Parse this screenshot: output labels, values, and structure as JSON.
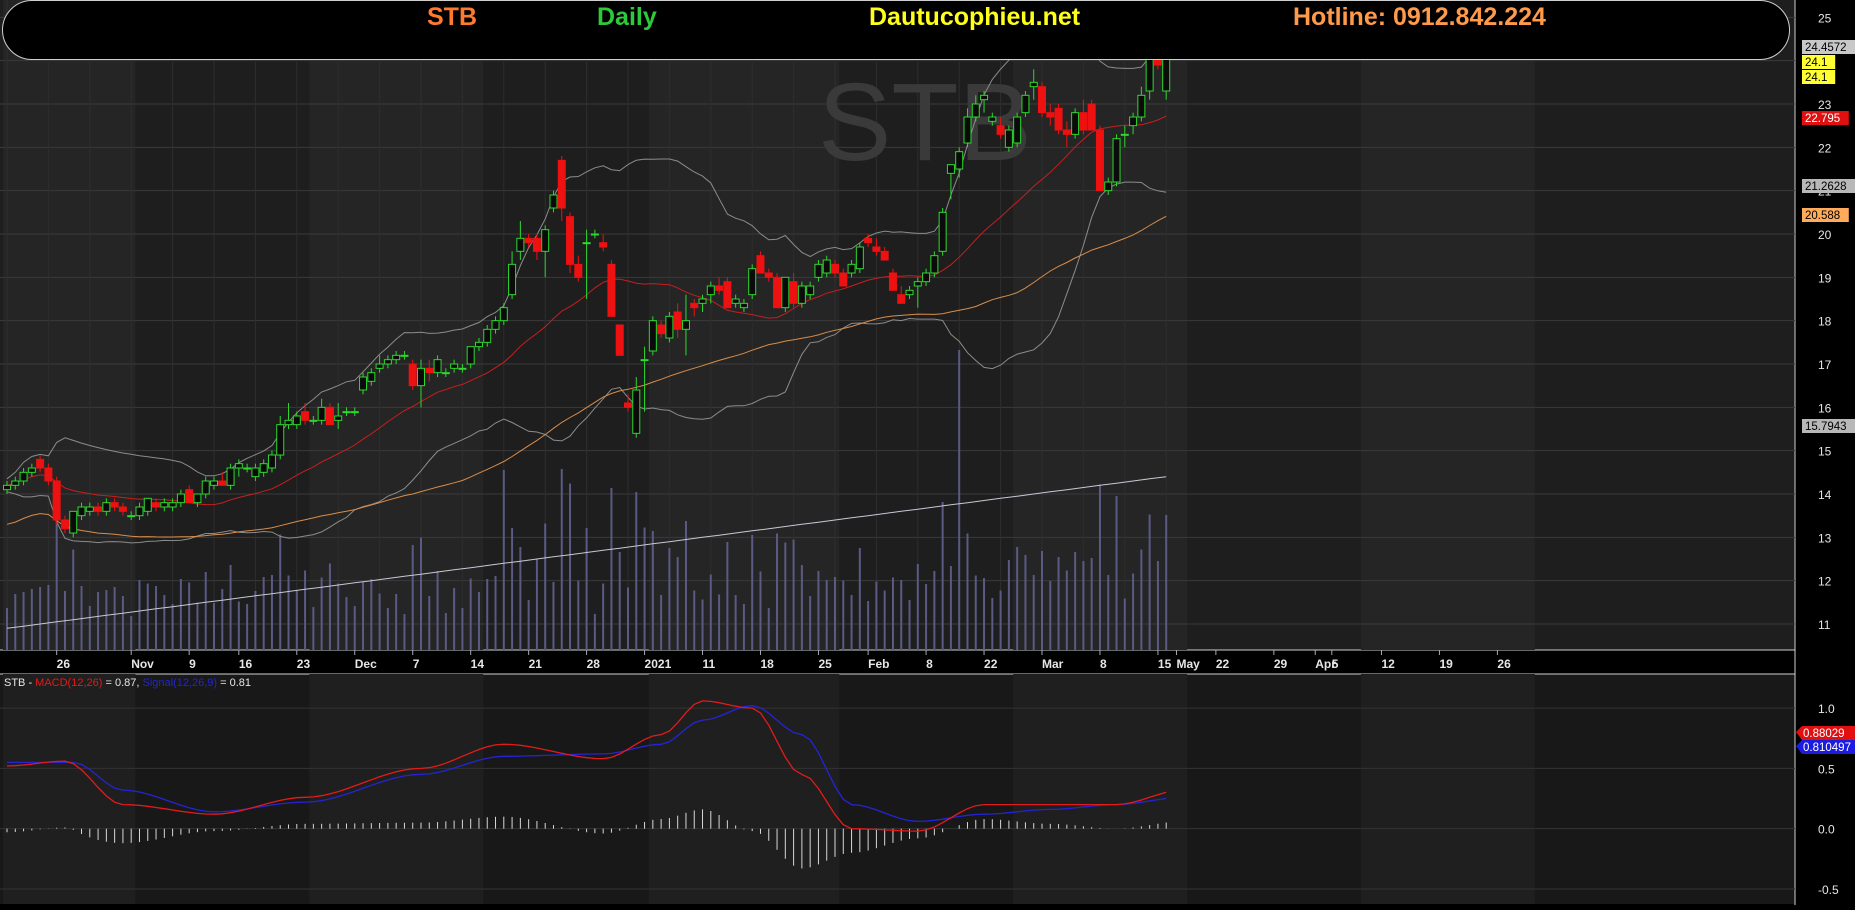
{
  "header": {
    "ticker": "STB",
    "period": "Daily",
    "site": "Dautucophieu.net",
    "hotline": "Hotline: 0912.842.224"
  },
  "chart_data": [
    {
      "type": "candlestick",
      "title": "STB",
      "x_tick_labels": [
        "26",
        "Nov",
        "9",
        "16",
        "23",
        "Dec",
        "7",
        "14",
        "21",
        "28",
        "2021",
        "11",
        "18",
        "25",
        "Feb",
        "8",
        "22",
        "Mar",
        "8",
        "15",
        "22",
        "29",
        "Apr",
        "5",
        "12",
        "19",
        "26",
        "May"
      ],
      "ylim": [
        10.4,
        25.4
      ],
      "y_ticks": [
        11,
        12,
        13,
        14,
        15,
        16,
        17,
        18,
        19,
        20,
        21,
        22,
        23,
        24,
        25
      ],
      "grid": true,
      "watermark": "STB",
      "candles": [
        [
          14.1,
          14.3,
          14.0,
          14.2
        ],
        [
          14.2,
          14.4,
          14.1,
          14.3
        ],
        [
          14.3,
          14.6,
          14.2,
          14.5
        ],
        [
          14.5,
          14.7,
          14.4,
          14.6
        ],
        [
          14.8,
          14.9,
          14.5,
          14.6
        ],
        [
          14.6,
          14.7,
          14.2,
          14.3
        ],
        [
          14.3,
          14.4,
          13.3,
          13.4
        ],
        [
          13.4,
          13.5,
          13.1,
          13.2
        ],
        [
          13.1,
          13.6,
          13.0,
          13.6
        ],
        [
          13.5,
          13.8,
          13.4,
          13.7
        ],
        [
          13.6,
          13.8,
          13.5,
          13.7
        ],
        [
          13.7,
          13.8,
          13.5,
          13.6
        ],
        [
          13.6,
          13.9,
          13.5,
          13.8
        ],
        [
          13.8,
          13.9,
          13.6,
          13.7
        ],
        [
          13.7,
          13.8,
          13.5,
          13.6
        ],
        [
          13.5,
          13.6,
          13.4,
          13.5
        ],
        [
          13.5,
          13.8,
          13.4,
          13.7
        ],
        [
          13.6,
          13.9,
          13.5,
          13.9
        ],
        [
          13.8,
          13.9,
          13.6,
          13.7
        ],
        [
          13.7,
          13.9,
          13.6,
          13.8
        ],
        [
          13.7,
          13.9,
          13.6,
          13.8
        ],
        [
          13.8,
          14.1,
          13.7,
          14.0
        ],
        [
          14.1,
          14.2,
          13.8,
          13.8
        ],
        [
          13.8,
          14.0,
          13.7,
          14.0
        ],
        [
          14.0,
          14.4,
          13.9,
          14.3
        ],
        [
          14.2,
          14.4,
          14.1,
          14.3
        ],
        [
          14.3,
          14.5,
          14.2,
          14.2
        ],
        [
          14.2,
          14.7,
          14.1,
          14.6
        ],
        [
          14.6,
          14.8,
          14.4,
          14.7
        ],
        [
          14.6,
          14.7,
          14.5,
          14.6
        ],
        [
          14.4,
          14.7,
          14.3,
          14.6
        ],
        [
          14.5,
          14.8,
          14.4,
          14.7
        ],
        [
          14.6,
          15.0,
          14.5,
          14.9
        ],
        [
          14.9,
          15.8,
          14.8,
          15.6
        ],
        [
          15.6,
          16.1,
          15.5,
          15.7
        ],
        [
          15.6,
          15.9,
          15.5,
          15.8
        ],
        [
          15.9,
          16.1,
          15.6,
          15.7
        ],
        [
          15.7,
          15.8,
          15.6,
          15.7
        ],
        [
          15.7,
          16.2,
          15.6,
          16.0
        ],
        [
          16.0,
          16.1,
          15.6,
          15.6
        ],
        [
          15.7,
          16.1,
          15.5,
          15.8
        ],
        [
          15.9,
          16.0,
          15.8,
          15.9
        ],
        [
          15.9,
          16.0,
          15.8,
          15.9
        ],
        [
          16.4,
          16.8,
          16.3,
          16.7
        ],
        [
          16.6,
          16.9,
          16.5,
          16.8
        ],
        [
          16.9,
          17.2,
          16.8,
          17.0
        ],
        [
          17.0,
          17.2,
          16.9,
          17.1
        ],
        [
          17.1,
          17.3,
          17.0,
          17.2
        ],
        [
          17.2,
          17.3,
          17.1,
          17.2
        ],
        [
          17.0,
          17.1,
          16.4,
          16.5
        ],
        [
          16.5,
          17.1,
          16.0,
          16.9
        ],
        [
          16.9,
          17.1,
          16.6,
          16.8
        ],
        [
          16.8,
          17.2,
          16.7,
          17.1
        ],
        [
          16.8,
          16.9,
          16.7,
          16.8
        ],
        [
          16.9,
          17.1,
          16.8,
          17.0
        ],
        [
          16.9,
          17.0,
          16.8,
          16.9
        ],
        [
          17.0,
          17.4,
          16.9,
          17.4
        ],
        [
          17.4,
          17.6,
          17.3,
          17.5
        ],
        [
          17.5,
          17.9,
          17.4,
          17.8
        ],
        [
          17.8,
          18.1,
          17.7,
          18.0
        ],
        [
          18.0,
          18.4,
          17.9,
          18.3
        ],
        [
          18.6,
          19.6,
          18.5,
          19.3
        ],
        [
          19.6,
          20.3,
          19.4,
          19.9
        ],
        [
          19.9,
          20.0,
          19.7,
          19.8
        ],
        [
          19.9,
          20.0,
          19.4,
          19.6
        ],
        [
          19.6,
          20.2,
          19.0,
          20.1
        ],
        [
          20.6,
          21.0,
          20.5,
          20.9
        ],
        [
          21.7,
          21.8,
          20.3,
          20.6
        ],
        [
          20.4,
          20.5,
          19.1,
          19.3
        ],
        [
          19.3,
          19.5,
          18.9,
          19.0
        ],
        [
          19.8,
          20.1,
          18.5,
          19.8
        ],
        [
          20.0,
          20.1,
          19.9,
          20.0
        ],
        [
          19.8,
          20.0,
          19.6,
          19.7
        ],
        [
          19.3,
          19.4,
          18.2,
          18.1
        ],
        [
          17.9,
          17.9,
          17.2,
          17.2
        ],
        [
          16.1,
          16.3,
          15.9,
          16.0
        ],
        [
          15.4,
          16.7,
          15.3,
          16.4
        ],
        [
          17.1,
          17.4,
          15.9,
          17.1
        ],
        [
          17.3,
          18.1,
          17.2,
          18.0
        ],
        [
          17.9,
          18.0,
          17.6,
          17.7
        ],
        [
          17.6,
          18.2,
          17.5,
          18.1
        ],
        [
          18.2,
          18.4,
          17.6,
          17.8
        ],
        [
          17.8,
          18.6,
          17.2,
          18.0
        ],
        [
          18.4,
          18.5,
          18.1,
          18.3
        ],
        [
          18.4,
          18.6,
          18.2,
          18.5
        ],
        [
          18.6,
          18.9,
          18.4,
          18.8
        ],
        [
          18.8,
          19.0,
          18.6,
          18.7
        ],
        [
          18.9,
          19.0,
          18.4,
          18.3
        ],
        [
          18.4,
          18.6,
          18.3,
          18.5
        ],
        [
          18.3,
          18.5,
          18.2,
          18.4
        ],
        [
          18.6,
          19.3,
          18.5,
          19.2
        ],
        [
          19.5,
          19.6,
          19.1,
          19.1
        ],
        [
          19.1,
          19.2,
          18.9,
          19.0
        ],
        [
          19.0,
          19.1,
          18.3,
          18.3
        ],
        [
          18.3,
          19.0,
          18.2,
          19.0
        ],
        [
          18.9,
          19.1,
          18.3,
          18.4
        ],
        [
          18.4,
          18.9,
          18.3,
          18.8
        ],
        [
          18.6,
          18.9,
          18.5,
          18.8
        ],
        [
          19.0,
          19.4,
          18.9,
          19.3
        ],
        [
          19.1,
          19.5,
          19.0,
          19.4
        ],
        [
          19.3,
          19.4,
          19.0,
          19.1
        ],
        [
          19.1,
          19.2,
          18.8,
          18.8
        ],
        [
          19.1,
          19.4,
          19.0,
          19.3
        ],
        [
          19.2,
          19.8,
          19.1,
          19.7
        ],
        [
          19.9,
          20.0,
          19.7,
          19.8
        ],
        [
          19.7,
          19.9,
          19.5,
          19.6
        ],
        [
          19.6,
          19.7,
          19.4,
          19.4
        ],
        [
          19.1,
          19.2,
          18.7,
          18.7
        ],
        [
          18.6,
          18.8,
          18.4,
          18.4
        ],
        [
          18.6,
          18.8,
          18.5,
          18.7
        ],
        [
          18.8,
          19.0,
          18.3,
          18.9
        ],
        [
          18.9,
          19.2,
          18.8,
          19.1
        ],
        [
          19.1,
          19.6,
          19.0,
          19.5
        ],
        [
          19.6,
          20.6,
          19.5,
          20.5
        ],
        [
          21.4,
          21.6,
          20.8,
          21.6
        ],
        [
          21.5,
          22.0,
          21.3,
          21.9
        ],
        [
          22.1,
          22.9,
          22.0,
          22.7
        ],
        [
          22.7,
          23.2,
          22.6,
          23.0
        ],
        [
          23.1,
          23.3,
          22.8,
          23.2
        ],
        [
          22.6,
          22.8,
          22.5,
          22.7
        ],
        [
          22.5,
          22.7,
          22.2,
          22.3
        ],
        [
          22.0,
          22.5,
          21.9,
          22.4
        ],
        [
          22.1,
          22.8,
          22.0,
          22.7
        ],
        [
          22.8,
          23.3,
          22.7,
          23.2
        ],
        [
          23.4,
          23.8,
          23.1,
          23.5
        ],
        [
          23.4,
          23.5,
          22.7,
          22.8
        ],
        [
          22.8,
          23.0,
          22.5,
          22.7
        ],
        [
          22.9,
          23.0,
          22.3,
          22.4
        ],
        [
          22.4,
          22.6,
          22.0,
          22.3
        ],
        [
          22.3,
          22.9,
          22.2,
          22.8
        ],
        [
          22.8,
          23.1,
          22.3,
          22.4
        ],
        [
          23.0,
          23.1,
          22.7,
          22.4
        ],
        [
          22.4,
          22.5,
          21.4,
          21.0
        ],
        [
          21.0,
          21.3,
          20.9,
          21.2
        ],
        [
          21.2,
          22.3,
          21.1,
          22.2
        ],
        [
          22.3,
          22.5,
          22.0,
          22.3
        ],
        [
          22.5,
          22.8,
          22.3,
          22.7
        ],
        [
          22.7,
          23.4,
          22.6,
          23.2
        ],
        [
          23.3,
          24.3,
          23.1,
          24.2
        ],
        [
          24.2,
          24.5,
          23.8,
          23.9
        ],
        [
          23.3,
          24.3,
          23.1,
          24.1
        ]
      ],
      "ma_red_value": 22.795,
      "ma_orange_value": 20.588,
      "bb_upper_value": 24.4572,
      "bb_lower_value": 21.2628,
      "ma_long_value": 15.7943,
      "last_close_labels": [
        "24.1",
        "24.1"
      ],
      "price_labels": [
        "24.4572",
        "24.1",
        "24.1",
        "22.795",
        "21.2628",
        "20.588",
        "15.7943"
      ]
    },
    {
      "type": "line",
      "title": "STB - MACD(12,26) = 0.87, Signal(12,26,9) = 0.81",
      "legend_parts": [
        "STB - ",
        "MACD(12,26)",
        " = 0.87, ",
        "Signal(12,26,9)",
        " = 0.81"
      ],
      "ylim": [
        -0.55,
        1.15
      ],
      "y_ticks": [
        -0.5,
        0.0,
        0.5,
        1.0
      ],
      "series": [
        {
          "name": "MACD(12,26)",
          "anchors": [
            [
              0,
              0.52
            ],
            [
              7,
              0.56
            ],
            [
              14,
              0.2
            ],
            [
              25,
              0.12
            ],
            [
              36,
              0.26
            ],
            [
              50,
              0.5
            ],
            [
              60,
              0.7
            ],
            [
              72,
              0.58
            ],
            [
              79,
              0.78
            ],
            [
              84,
              1.06
            ],
            [
              90,
              1.0
            ],
            [
              96,
              0.45
            ],
            [
              102,
              0.0
            ],
            [
              110,
              -0.02
            ],
            [
              118,
              0.2
            ],
            [
              126,
              0.2
            ],
            [
              134,
              0.2
            ],
            [
              142,
              0.32
            ],
            [
              150,
              0.15
            ],
            [
              156,
              0.1
            ],
            [
              162,
              0.8
            ],
            [
              168,
              1.05
            ],
            [
              174,
              1.12
            ],
            [
              180,
              1.0
            ],
            [
              186,
              0.7
            ],
            [
              191,
              0.68
            ],
            [
              196,
              0.87
            ],
            [
              199,
              0.88
            ]
          ]
        },
        {
          "name": "Signal(12,26,9)",
          "anchors": [
            [
              0,
              0.55
            ],
            [
              8,
              0.55
            ],
            [
              14,
              0.32
            ],
            [
              25,
              0.14
            ],
            [
              36,
              0.22
            ],
            [
              50,
              0.45
            ],
            [
              60,
              0.6
            ],
            [
              72,
              0.62
            ],
            [
              79,
              0.7
            ],
            [
              84,
              0.9
            ],
            [
              90,
              1.02
            ],
            [
              96,
              0.78
            ],
            [
              102,
              0.2
            ],
            [
              110,
              0.06
            ],
            [
              118,
              0.12
            ],
            [
              126,
              0.16
            ],
            [
              134,
              0.2
            ],
            [
              142,
              0.26
            ],
            [
              150,
              0.2
            ],
            [
              156,
              0.14
            ],
            [
              162,
              0.55
            ],
            [
              168,
              0.87
            ],
            [
              174,
              1.0
            ],
            [
              180,
              1.0
            ],
            [
              186,
              0.88
            ],
            [
              191,
              0.78
            ],
            [
              196,
              0.82
            ],
            [
              199,
              0.88
            ]
          ]
        }
      ],
      "last_labels": [
        "0.88029",
        "0.810497"
      ]
    }
  ],
  "colors": {
    "background": "#000000",
    "plot_bg": "#1e1e1e",
    "up_candle": "#2ed82e",
    "down_candle": "#ee1111",
    "macd": "#e21b1b",
    "signal": "#2424d6",
    "ma_red": "#c81e1e",
    "ma_orange": "#d98d49",
    "ma_long": "#c8c8d6",
    "bollinger": "#8c8c8c",
    "volume": "#5a5a84"
  }
}
